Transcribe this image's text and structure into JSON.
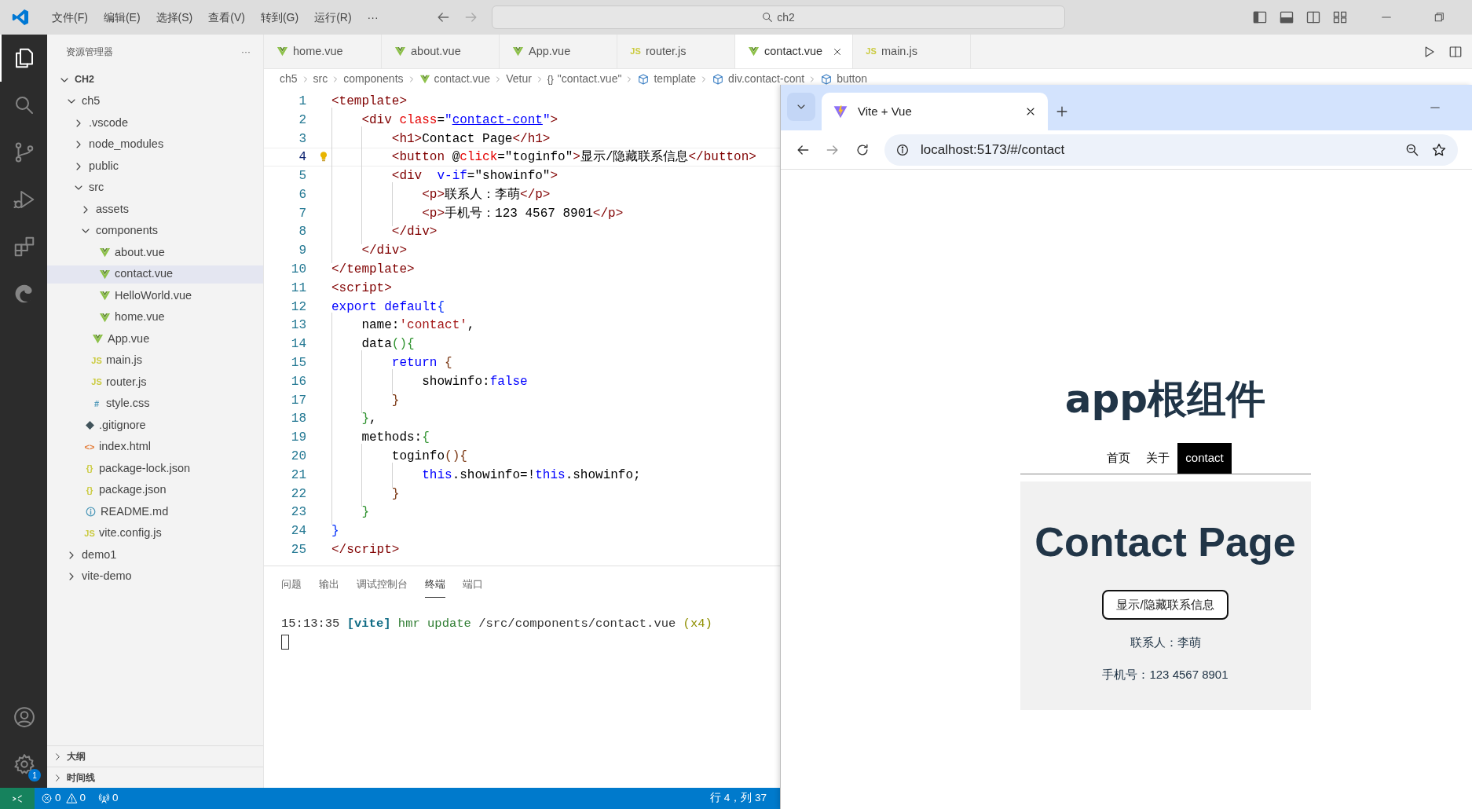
{
  "title_bar": {
    "menu": [
      "文件(F)",
      "编辑(E)",
      "选择(S)",
      "查看(V)",
      "转到(G)",
      "运行(R)",
      "···"
    ],
    "search": {
      "value": "ch2"
    }
  },
  "activity_bar": {
    "items": [
      {
        "kind": "explorer",
        "selected": true
      },
      {
        "kind": "search",
        "selected": false
      },
      {
        "kind": "source-control",
        "selected": false
      },
      {
        "kind": "run-debug",
        "selected": false
      },
      {
        "kind": "extensions",
        "selected": false
      },
      {
        "kind": "browser",
        "selected": false
      }
    ],
    "bottom": [
      {
        "kind": "account"
      },
      {
        "kind": "settings",
        "badge": "1"
      }
    ]
  },
  "sidebar": {
    "title": "资源管理器",
    "more": "···",
    "tree": [
      {
        "label": "CH2",
        "kind": "root",
        "expanded": true,
        "selected": false,
        "children": [
          {
            "label": "ch5",
            "kind": "folder",
            "expanded": true,
            "selected": false,
            "children": [
              {
                "label": ".vscode",
                "kind": "folder",
                "expanded": false,
                "selected": false
              },
              {
                "label": "node_modules",
                "kind": "folder",
                "expanded": false,
                "selected": false
              },
              {
                "label": "public",
                "kind": "folder",
                "expanded": false,
                "selected": false
              },
              {
                "label": "src",
                "kind": "folder",
                "expanded": true,
                "selected": false,
                "children": [
                  {
                    "label": "assets",
                    "kind": "folder",
                    "expanded": false,
                    "selected": false
                  },
                  {
                    "label": "components",
                    "kind": "folder",
                    "expanded": true,
                    "selected": false,
                    "children": [
                      {
                        "label": "about.vue",
                        "kind": "vue",
                        "selected": false
                      },
                      {
                        "label": "contact.vue",
                        "kind": "vue",
                        "selected": true
                      },
                      {
                        "label": "HelloWorld.vue",
                        "kind": "vue",
                        "selected": false
                      },
                      {
                        "label": "home.vue",
                        "kind": "vue",
                        "selected": false
                      }
                    ]
                  },
                  {
                    "label": "App.vue",
                    "kind": "vue",
                    "selected": false
                  },
                  {
                    "label": "main.js",
                    "kind": "js",
                    "glyph": "JS",
                    "selected": false
                  },
                  {
                    "label": "router.js",
                    "kind": "js",
                    "glyph": "JS",
                    "selected": false
                  },
                  {
                    "label": "style.css",
                    "kind": "css",
                    "glyph": "#",
                    "selected": false
                  }
                ]
              },
              {
                "label": ".gitignore",
                "kind": "git",
                "selected": false
              },
              {
                "label": "index.html",
                "kind": "html",
                "glyph": "<>",
                "selected": false
              },
              {
                "label": "package-lock.json",
                "kind": "json",
                "glyph": "{}",
                "selected": false
              },
              {
                "label": "package.json",
                "kind": "json",
                "glyph": "{}",
                "selected": false
              },
              {
                "label": "README.md",
                "kind": "md",
                "selected": false
              },
              {
                "label": "vite.config.js",
                "kind": "js",
                "glyph": "JS",
                "selected": false
              }
            ]
          },
          {
            "label": "demo1",
            "kind": "folder",
            "expanded": false,
            "selected": false
          },
          {
            "label": "vite-demo",
            "kind": "folder",
            "expanded": false,
            "selected": false
          }
        ]
      }
    ],
    "sections": [
      {
        "label": "大纲",
        "expanded": false
      },
      {
        "label": "时间线",
        "expanded": false
      }
    ]
  },
  "editor_tabs": [
    {
      "label": "home.vue",
      "kind": "vue",
      "selected": false
    },
    {
      "label": "about.vue",
      "kind": "vue",
      "selected": false
    },
    {
      "label": "App.vue",
      "kind": "vue",
      "selected": false
    },
    {
      "label": "router.js",
      "kind": "js",
      "glyph": "JS",
      "selected": false
    },
    {
      "label": "contact.vue",
      "kind": "vue",
      "selected": true
    },
    {
      "label": "main.js",
      "kind": "js",
      "glyph": "JS",
      "selected": false
    }
  ],
  "breadcrumb": [
    {
      "label": "ch5",
      "kind": "text"
    },
    {
      "label": "src",
      "kind": "text"
    },
    {
      "label": "components",
      "kind": "text"
    },
    {
      "label": "contact.vue",
      "kind": "vue"
    },
    {
      "label": "Vetur",
      "kind": "text"
    },
    {
      "label": "\"contact.vue\"",
      "kind": "braces",
      "glyph": "{}"
    },
    {
      "label": "template",
      "kind": "symbol"
    },
    {
      "label": "div.contact-cont",
      "kind": "symbol"
    },
    {
      "label": "button",
      "kind": "symbol"
    }
  ],
  "code": [
    {
      "n": "1",
      "current": false,
      "tokens": [
        {
          "kind": "tag",
          "text": "<template>"
        }
      ]
    },
    {
      "n": "2",
      "current": false,
      "tokens": [
        {
          "kind": "tag",
          "text": "    <div "
        },
        {
          "kind": "attr",
          "text": "class"
        },
        {
          "kind": "plain",
          "text": "="
        },
        {
          "kind": "str",
          "text": "\""
        },
        {
          "kind": "link",
          "text": "contact-cont"
        },
        {
          "kind": "str",
          "text": "\""
        },
        {
          "kind": "tag",
          "text": ">"
        }
      ]
    },
    {
      "n": "3",
      "current": false,
      "tokens": [
        {
          "kind": "tag",
          "text": "        <h1>"
        },
        {
          "kind": "plain",
          "text": "Contact Page"
        },
        {
          "kind": "tag",
          "text": "</h1>"
        }
      ]
    },
    {
      "n": "4",
      "current": true,
      "tokens": [
        {
          "kind": "tag",
          "text": "        <button "
        },
        {
          "kind": "plain",
          "text": "@"
        },
        {
          "kind": "attr",
          "text": "click"
        },
        {
          "kind": "plain",
          "text": "=\"toginfo\""
        },
        {
          "kind": "tag",
          "text": ">"
        },
        {
          "kind": "plain",
          "text": "显示/隐藏联系信息"
        },
        {
          "kind": "tag",
          "text": "</button>"
        }
      ]
    },
    {
      "n": "5",
      "current": false,
      "tokens": [
        {
          "kind": "tag",
          "text": "        <div  "
        },
        {
          "kind": "kw",
          "text": "v-if"
        },
        {
          "kind": "plain",
          "text": "=\"showinfo\""
        },
        {
          "kind": "tag",
          "text": ">"
        }
      ]
    },
    {
      "n": "6",
      "current": false,
      "tokens": [
        {
          "kind": "tag",
          "text": "            <p>"
        },
        {
          "kind": "plain",
          "text": "联系人：李萌"
        },
        {
          "kind": "tag",
          "text": "</p>"
        }
      ]
    },
    {
      "n": "7",
      "current": false,
      "tokens": [
        {
          "kind": "tag",
          "text": "            <p>"
        },
        {
          "kind": "plain",
          "text": "手机号：123 4567 8901"
        },
        {
          "kind": "tag",
          "text": "</p>"
        }
      ]
    },
    {
      "n": "8",
      "current": false,
      "tokens": [
        {
          "kind": "tag",
          "text": "        </div>"
        }
      ]
    },
    {
      "n": "9",
      "current": false,
      "tokens": [
        {
          "kind": "tag",
          "text": "    </div>"
        }
      ]
    },
    {
      "n": "10",
      "current": false,
      "tokens": [
        {
          "kind": "tag",
          "text": "</template>"
        }
      ]
    },
    {
      "n": "11",
      "current": false,
      "tokens": [
        {
          "kind": "tag",
          "text": "<script>"
        }
      ]
    },
    {
      "n": "12",
      "current": false,
      "tokens": [
        {
          "kind": "kw",
          "text": "export default"
        },
        {
          "kind": "b1",
          "text": "{"
        }
      ]
    },
    {
      "n": "13",
      "current": false,
      "tokens": [
        {
          "kind": "plain",
          "text": "    name:"
        },
        {
          "kind": "jsstr",
          "text": "'contact'"
        },
        {
          "kind": "plain",
          "text": ","
        }
      ]
    },
    {
      "n": "14",
      "current": false,
      "tokens": [
        {
          "kind": "plain",
          "text": "    data"
        },
        {
          "kind": "b2",
          "text": "(){"
        }
      ]
    },
    {
      "n": "15",
      "current": false,
      "tokens": [
        {
          "kind": "kw",
          "text": "        return "
        },
        {
          "kind": "b3",
          "text": "{"
        }
      ]
    },
    {
      "n": "16",
      "current": false,
      "tokens": [
        {
          "kind": "plain",
          "text": "            showinfo:"
        },
        {
          "kind": "kw",
          "text": "false"
        }
      ]
    },
    {
      "n": "17",
      "current": false,
      "tokens": [
        {
          "kind": "b3",
          "text": "        }"
        }
      ]
    },
    {
      "n": "18",
      "current": false,
      "tokens": [
        {
          "kind": "b2",
          "text": "    }"
        },
        {
          "kind": "plain",
          "text": ","
        }
      ]
    },
    {
      "n": "19",
      "current": false,
      "tokens": [
        {
          "kind": "plain",
          "text": "    methods:"
        },
        {
          "kind": "b2",
          "text": "{"
        }
      ]
    },
    {
      "n": "20",
      "current": false,
      "tokens": [
        {
          "kind": "plain",
          "text": "        toginfo"
        },
        {
          "kind": "b3",
          "text": "(){"
        }
      ]
    },
    {
      "n": "21",
      "current": false,
      "tokens": [
        {
          "kind": "kw",
          "text": "            this"
        },
        {
          "kind": "plain",
          "text": ".showinfo=!"
        },
        {
          "kind": "kw",
          "text": "this"
        },
        {
          "kind": "plain",
          "text": ".showinfo;"
        }
      ]
    },
    {
      "n": "22",
      "current": false,
      "tokens": [
        {
          "kind": "b3",
          "text": "        }"
        }
      ]
    },
    {
      "n": "23",
      "current": false,
      "tokens": [
        {
          "kind": "b2",
          "text": "    }"
        }
      ]
    },
    {
      "n": "24",
      "current": false,
      "tokens": [
        {
          "kind": "b1",
          "text": "}"
        }
      ]
    },
    {
      "n": "25",
      "current": false,
      "tokens": [
        {
          "kind": "tag",
          "text": "</script>"
        }
      ]
    }
  ],
  "panel": {
    "tabs": [
      {
        "label": "问题",
        "selected": false
      },
      {
        "label": "输出",
        "selected": false
      },
      {
        "label": "调试控制台",
        "selected": false
      },
      {
        "label": "终端",
        "selected": true
      },
      {
        "label": "端口",
        "selected": false
      }
    ],
    "terminal": [
      {
        "kind": "plain",
        "text": "15:13:35 "
      },
      {
        "kind": "vite",
        "text": "[vite]"
      },
      {
        "kind": "hmr",
        "text": " hmr update"
      },
      {
        "kind": "plain",
        "text": " /src/components/contact.vue"
      },
      {
        "kind": "count",
        "text": " (x4)"
      }
    ]
  },
  "status_bar": {
    "errors": "0",
    "warnings": "0",
    "ports": "0",
    "position": "行 4，列 37"
  },
  "browser": {
    "tab": {
      "title": "Vite + Vue"
    },
    "url": "localhost:5173/#/contact",
    "page": {
      "heading": "app根组件",
      "nav": [
        {
          "label": "首页",
          "selected": false
        },
        {
          "label": "关于",
          "selected": false
        },
        {
          "label": "contact",
          "selected": true
        }
      ],
      "card": {
        "title": "Contact Page",
        "button": "显示/隐藏联系信息",
        "lines": [
          "联系人：李萌",
          "手机号：123 4567 8901"
        ]
      }
    }
  }
}
